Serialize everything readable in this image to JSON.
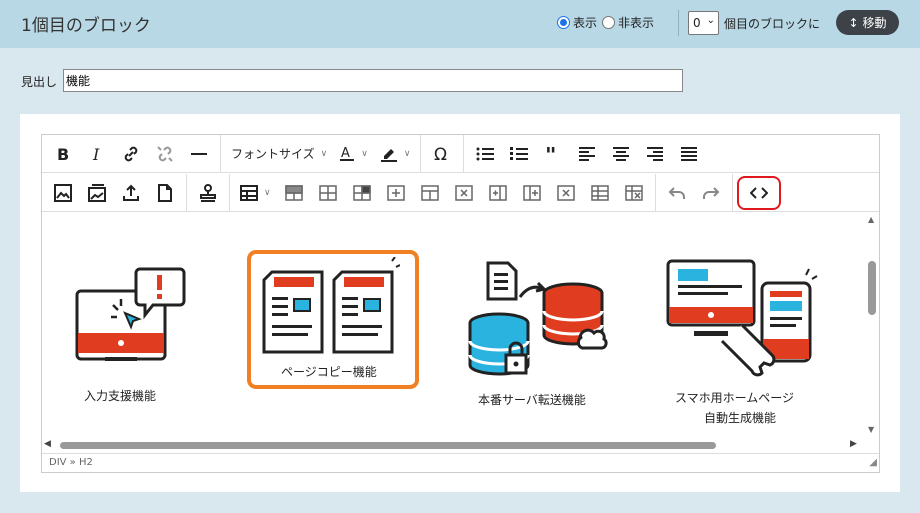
{
  "header": {
    "title": "1個目のブロック",
    "visibility_options": [
      {
        "label": "表示",
        "selected": true
      },
      {
        "label": "非表示",
        "selected": false
      }
    ],
    "position_select_value": "0",
    "position_caption": "個目のブロックに",
    "move_button_label": "移動"
  },
  "heading": {
    "label": "見出し",
    "value": "機能"
  },
  "toolbar": {
    "font_size_label": "フォントサイズ",
    "row1_icons": [
      "bold-icon",
      "italic-icon",
      "link-icon",
      "unlink-icon",
      "horizontal-line-icon",
      "font-color-icon",
      "highlight-icon",
      "special-char-icon",
      "bullet-list-icon",
      "numbered-list-icon",
      "blockquote-icon",
      "align-left-icon",
      "align-center-icon",
      "align-right-icon",
      "align-justify-icon"
    ],
    "row2_icons": [
      "image-icon",
      "image-gallery-icon",
      "upload-icon",
      "file-icon",
      "stamp-icon",
      "table-icon",
      "table-row-above-icon",
      "table-row-below-icon",
      "table-cell-merge-icon",
      "table-col-left-icon",
      "table-col-right-icon",
      "table-delete-row-icon",
      "table-insert-col-icon",
      "table-delete-col-icon",
      "table-props-icon",
      "table-delete-icon",
      "undo-icon",
      "redo-icon",
      "source-code-icon"
    ]
  },
  "content": {
    "features": [
      {
        "caption": "入力支援機能",
        "icon": "monitor-cursor-alert-icon"
      },
      {
        "caption": "ページコピー機能",
        "icon": "page-copy-icon",
        "highlighted": true
      },
      {
        "caption": "本番サーバ転送機能",
        "icon": "server-transfer-icon"
      },
      {
        "caption_line1": "スマホ用ホームページ",
        "caption_line2": "自動生成機能",
        "icon": "smartphone-site-generate-icon"
      }
    ]
  },
  "status_bar": {
    "path": "DIV » H2"
  },
  "colors": {
    "accent_red": "#e03c1f",
    "accent_blue": "#2bb3e0",
    "highlight_orange": "#f08023",
    "code_button_border": "#e0191f"
  }
}
